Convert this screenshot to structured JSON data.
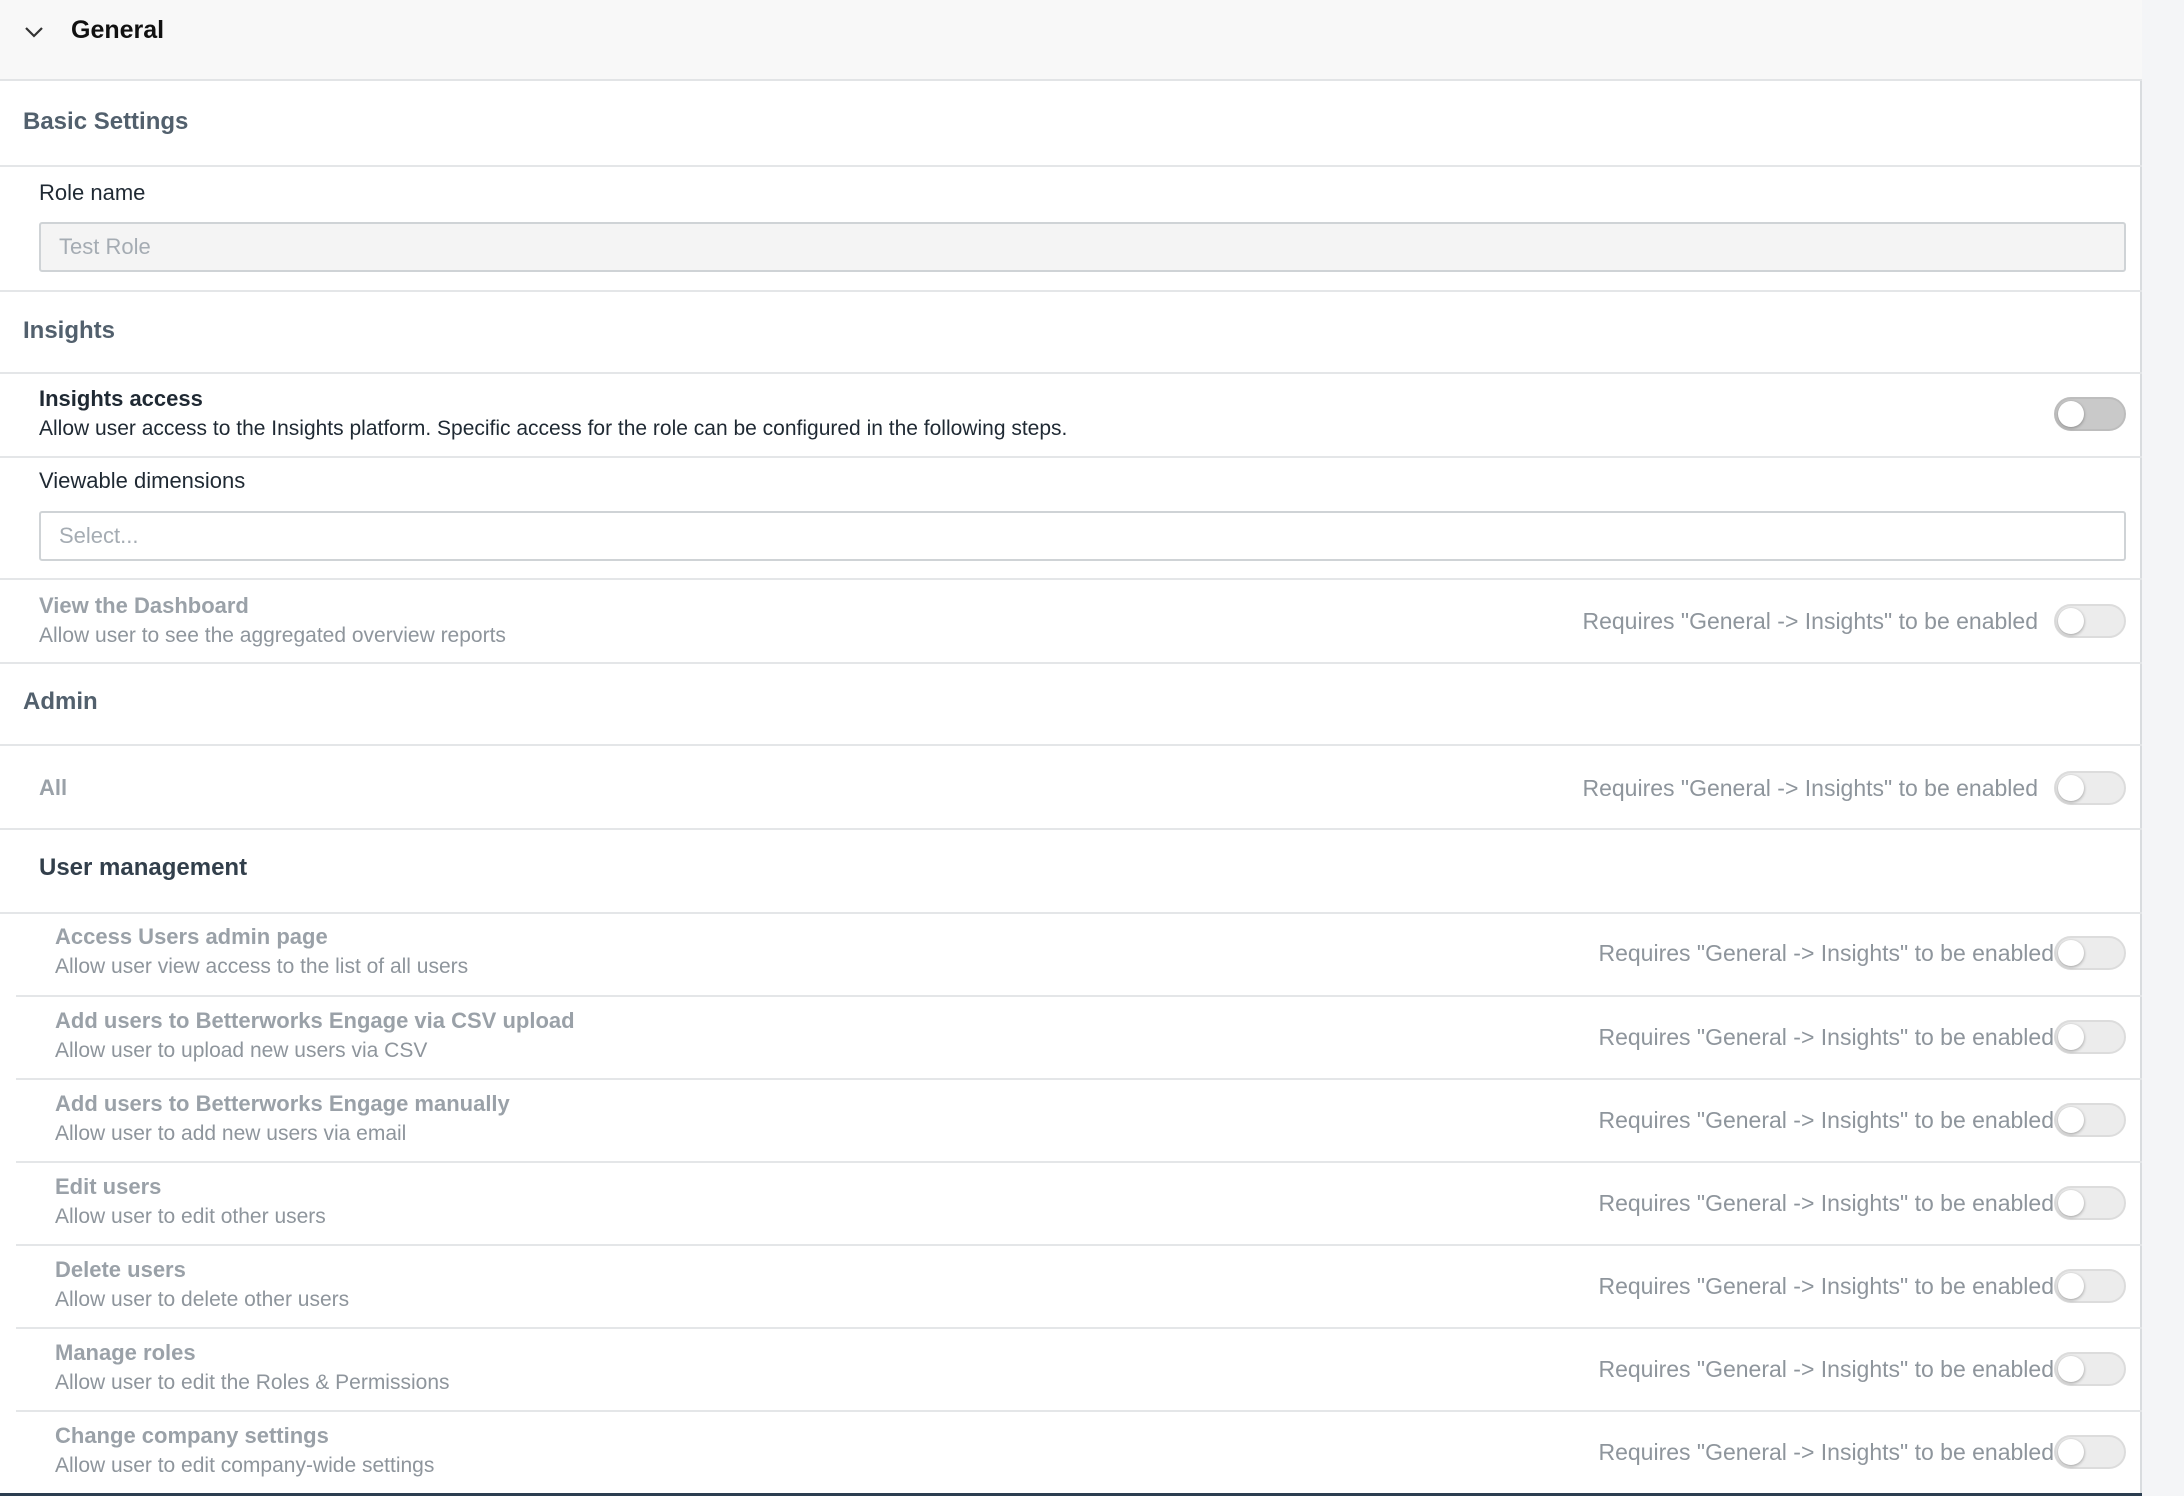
{
  "header": {
    "title": "General"
  },
  "basic_settings": {
    "heading": "Basic Settings",
    "role_name_label": "Role name",
    "role_name_value": "Test Role"
  },
  "insights": {
    "heading": "Insights",
    "access": {
      "title": "Insights access",
      "description": "Allow user access to the Insights platform. Specific access for the role can be configured in the following steps."
    },
    "viewable_dimensions_label": "Viewable dimensions",
    "viewable_dimensions_placeholder": "Select...",
    "dashboard": {
      "title": "View the Dashboard",
      "description": "Allow user to see the aggregated overview reports",
      "requirement": "Requires \"General -> Insights\" to be enabled"
    }
  },
  "admin": {
    "heading": "Admin",
    "all": {
      "title": "All",
      "requirement": "Requires \"General -> Insights\" to be enabled"
    },
    "user_management_heading": "User management",
    "items": [
      {
        "title": "Access Users admin page",
        "description": "Allow user view access to the list of all users",
        "requirement": "Requires \"General -> Insights\" to be enabled"
      },
      {
        "title": "Add users to Betterworks Engage via CSV upload",
        "description": "Allow user to upload new users via CSV",
        "requirement": "Requires \"General -> Insights\" to be enabled"
      },
      {
        "title": "Add users to Betterworks Engage manually",
        "description": "Allow user to add new users via email",
        "requirement": "Requires \"General -> Insights\" to be enabled"
      },
      {
        "title": "Edit users",
        "description": "Allow user to edit other users",
        "requirement": "Requires \"General -> Insights\" to be enabled"
      },
      {
        "title": "Delete users",
        "description": "Allow user to delete other users",
        "requirement": "Requires \"General -> Insights\" to be enabled"
      },
      {
        "title": "Manage roles",
        "description": "Allow user to edit the Roles & Permissions",
        "requirement": "Requires \"General -> Insights\" to be enabled"
      },
      {
        "title": "Change company settings",
        "description": "Allow user to edit company-wide settings",
        "requirement": "Requires \"General -> Insights\" to be enabled"
      }
    ]
  },
  "icons": {
    "collapse": "chevron-down-icon"
  }
}
